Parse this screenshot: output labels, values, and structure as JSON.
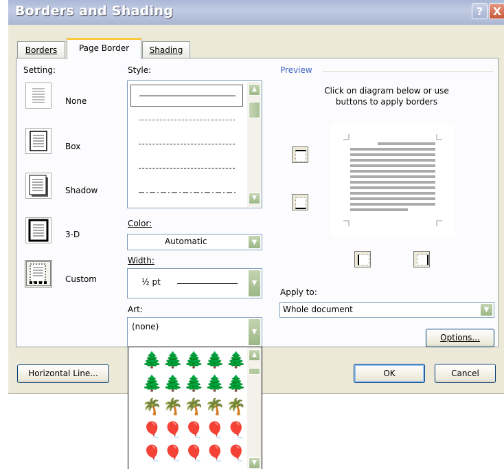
{
  "window": {
    "title": "Borders and Shading",
    "help": "?",
    "close": "X"
  },
  "tabs": [
    {
      "label": "Borders",
      "active": false
    },
    {
      "label": "Page Border",
      "active": true
    },
    {
      "label": "Shading",
      "active": false
    }
  ],
  "setting": {
    "label": "Setting:",
    "options": [
      "None",
      "Box",
      "Shadow",
      "3-D",
      "Custom"
    ],
    "selected": "Custom"
  },
  "style": {
    "label": "Style:"
  },
  "color": {
    "label": "Color:",
    "value": "Automatic"
  },
  "width": {
    "label": "Width:",
    "value": "½ pt"
  },
  "art": {
    "label": "Art:",
    "value": "(none)",
    "options": [
      {
        "icon": "evergreen-tree-icon",
        "glyph": "🌲",
        "color": "#2d8a2d"
      },
      {
        "icon": "dark-tree-icon",
        "glyph": "🌲",
        "color": "#1f3a1f"
      },
      {
        "icon": "palm-tree-icon",
        "glyph": "🌴",
        "color": "#3d2a1a"
      },
      {
        "icon": "balloons-icon",
        "glyph": "🎈",
        "color": "#b03ab0"
      },
      {
        "icon": "hot-air-balloon-icon",
        "glyph": "🎈",
        "color": "#7030a0"
      }
    ]
  },
  "preview": {
    "label": "Preview",
    "instruction": "Click on diagram below or use buttons to apply borders"
  },
  "apply_to": {
    "label": "Apply to:",
    "value": "Whole document"
  },
  "buttons": {
    "options": "Options...",
    "horizontal_line": "Horizontal Line...",
    "ok": "OK",
    "cancel": "Cancel"
  },
  "colors": {
    "dialog_bg": "#ece9d8",
    "panel_bg": "#fcfcfe",
    "tab_accent": "#ffc83c",
    "button_border": "#003c74"
  }
}
